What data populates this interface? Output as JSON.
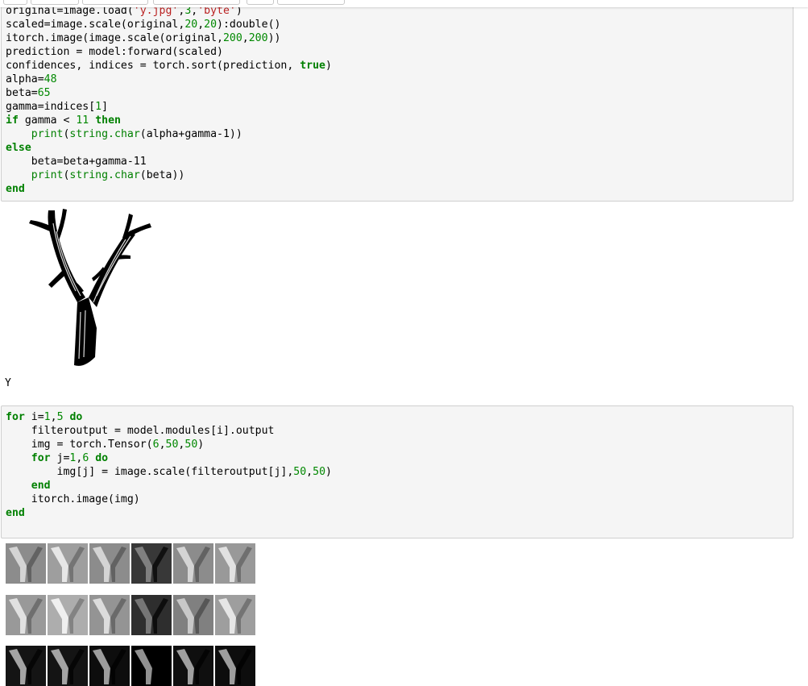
{
  "cell1": {
    "lines": [
      [
        {
          "t": "original=image.load("
        },
        {
          "t": "'y.jpg'",
          "c": "str"
        },
        {
          "t": ","
        },
        {
          "t": "3",
          "c": "num"
        },
        {
          "t": ","
        },
        {
          "t": "'byte'",
          "c": "str"
        },
        {
          "t": ")"
        }
      ],
      [
        {
          "t": "scaled=image.scale(original,"
        },
        {
          "t": "20",
          "c": "num"
        },
        {
          "t": ","
        },
        {
          "t": "20",
          "c": "num"
        },
        {
          "t": "):double()"
        }
      ],
      [
        {
          "t": "itorch.image(image.scale(original,"
        },
        {
          "t": "200",
          "c": "num"
        },
        {
          "t": ","
        },
        {
          "t": "200",
          "c": "num"
        },
        {
          "t": "))"
        }
      ],
      [
        {
          "t": "prediction = model:forward(scaled)"
        }
      ],
      [
        {
          "t": "confidences, indices = torch.sort(prediction, "
        },
        {
          "t": "true",
          "c": "kw"
        },
        {
          "t": ")"
        }
      ],
      [
        {
          "t": "alpha="
        },
        {
          "t": "48",
          "c": "num"
        }
      ],
      [
        {
          "t": "beta="
        },
        {
          "t": "65",
          "c": "num"
        }
      ],
      [
        {
          "t": "gamma=indices["
        },
        {
          "t": "1",
          "c": "num"
        },
        {
          "t": "]"
        }
      ],
      [
        {
          "t": "if",
          "c": "kw"
        },
        {
          "t": " gamma < "
        },
        {
          "t": "11",
          "c": "num"
        },
        {
          "t": " "
        },
        {
          "t": "then",
          "c": "kw"
        }
      ],
      [
        {
          "t": "    "
        },
        {
          "t": "print",
          "c": "bi"
        },
        {
          "t": "("
        },
        {
          "t": "string.char",
          "c": "bi"
        },
        {
          "t": "(alpha+gamma-1))"
        }
      ],
      [
        {
          "t": "else",
          "c": "kw"
        }
      ],
      [
        {
          "t": "    beta=beta+gamma-11"
        }
      ],
      [
        {
          "t": "    "
        },
        {
          "t": "print",
          "c": "bi"
        },
        {
          "t": "("
        },
        {
          "t": "string.char",
          "c": "bi"
        },
        {
          "t": "(beta))"
        }
      ],
      [
        {
          "t": "end",
          "c": "kw"
        }
      ]
    ]
  },
  "output1": {
    "text": "Y"
  },
  "cell2": {
    "lines": [
      [
        {
          "t": "for",
          "c": "kw"
        },
        {
          "t": " i="
        },
        {
          "t": "1",
          "c": "num"
        },
        {
          "t": ","
        },
        {
          "t": "5",
          "c": "num"
        },
        {
          "t": " "
        },
        {
          "t": "do",
          "c": "kw"
        }
      ],
      [
        {
          "t": "    filteroutput = model.modules[i].output"
        }
      ],
      [
        {
          "t": "    img = torch.Tensor("
        },
        {
          "t": "6",
          "c": "num"
        },
        {
          "t": ","
        },
        {
          "t": "50",
          "c": "num"
        },
        {
          "t": ","
        },
        {
          "t": "50",
          "c": "num"
        },
        {
          "t": ")"
        }
      ],
      [
        {
          "t": "    "
        },
        {
          "t": "for",
          "c": "kw"
        },
        {
          "t": " j="
        },
        {
          "t": "1",
          "c": "num"
        },
        {
          "t": ","
        },
        {
          "t": "6",
          "c": "num"
        },
        {
          "t": " "
        },
        {
          "t": "do",
          "c": "kw"
        }
      ],
      [
        {
          "t": "        img[j] = image.scale(filteroutput[j],"
        },
        {
          "t": "50",
          "c": "num"
        },
        {
          "t": ","
        },
        {
          "t": "50",
          "c": "num"
        },
        {
          "t": ")"
        }
      ],
      [
        {
          "t": "    "
        },
        {
          "t": "end",
          "c": "kw"
        }
      ],
      [
        {
          "t": "    itorch.image(img)"
        }
      ],
      [
        {
          "t": "end",
          "c": "kw"
        }
      ]
    ]
  },
  "feature_maps": {
    "rows": [
      {
        "brightness": [
          0.55,
          0.62,
          0.55,
          0.22,
          0.55,
          0.6
        ]
      },
      {
        "brightness": [
          0.6,
          0.68,
          0.58,
          0.18,
          0.5,
          0.62
        ]
      },
      {
        "brightness": [
          0.08,
          0.08,
          0.05,
          0.0,
          0.06,
          0.05
        ]
      }
    ]
  }
}
